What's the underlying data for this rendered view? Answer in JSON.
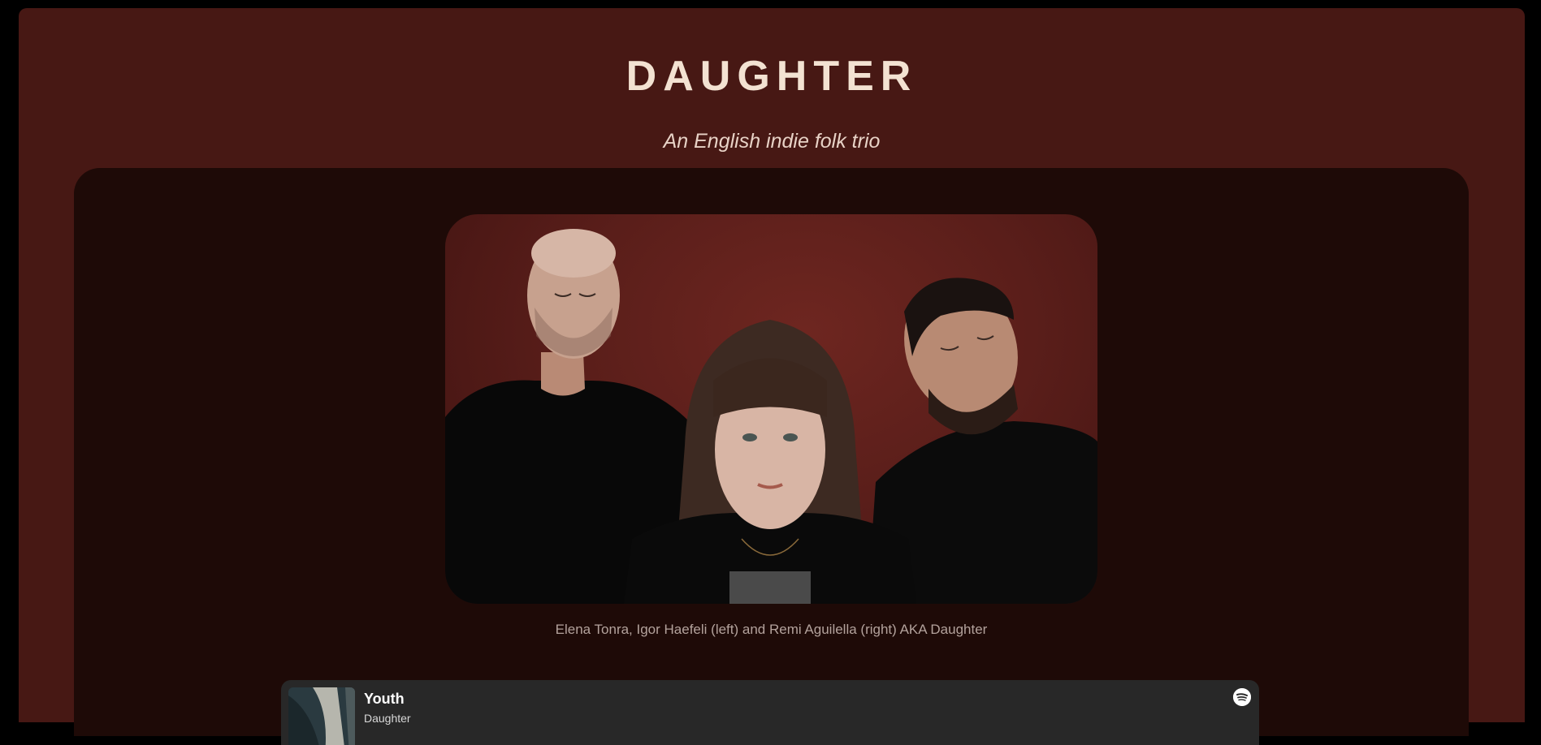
{
  "header": {
    "title": "DAUGHTER",
    "subtitle": "An English indie folk trio"
  },
  "photo": {
    "alt": "Elena Tonra, Igor Haefeli and Remi Aguilella",
    "caption": "Elena Tonra, Igor Haefeli (left) and Remi Aguilella (right) AKA Daughter"
  },
  "player": {
    "track_title": "Youth",
    "artist": "Daughter",
    "service_icon": "spotify-icon"
  },
  "colors": {
    "page_background": "#000000",
    "card_background": "#471814",
    "panel_background": "#1e0a07",
    "title_color": "#f3e2d2",
    "player_background": "#282828"
  }
}
